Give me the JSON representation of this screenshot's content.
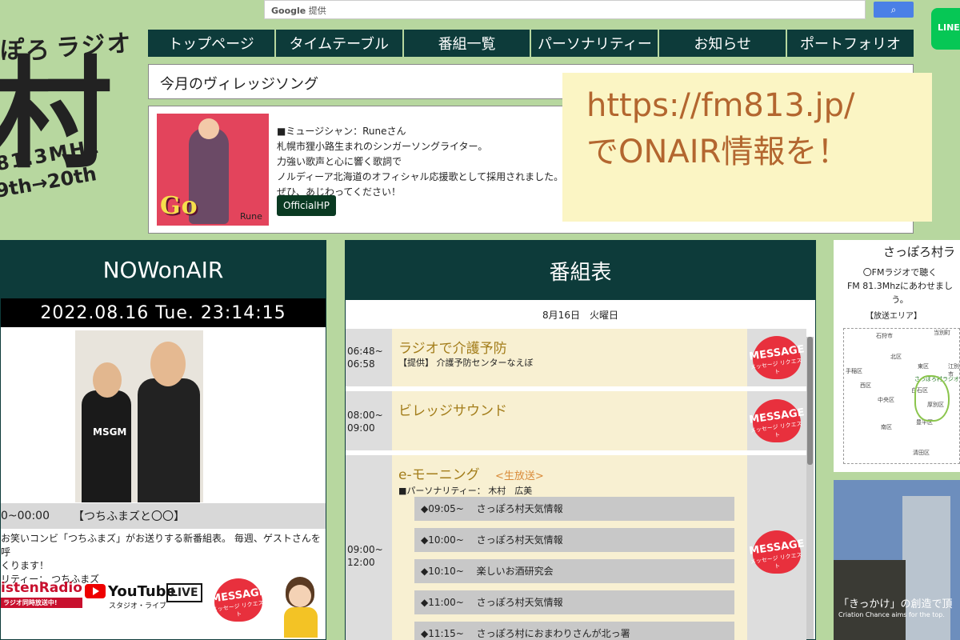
{
  "logo": {
    "line1": "ぽろ",
    "line2": "ラジオ",
    "big": "村",
    "freq": "81.3MHz",
    "sched": "9th→20th"
  },
  "search": {
    "label": "Google",
    "label_small": "提供",
    "button_icon": "search-icon"
  },
  "line_badge": "LINE",
  "nav": [
    "トップページ",
    "タイムテーブル",
    "番組一覧",
    "パーソナリティー",
    "お知らせ",
    "ポートフォリオ"
  ],
  "village_song": {
    "heading": "今月のヴィレッジソング"
  },
  "artist": {
    "lines": [
      "■ミュージシャン：Runeさん",
      "札幌市狸小路生まれのシンガーソングライター。",
      "力強い歌声と心に響く歌詞で",
      "ノルディーア北海道のオフィシャル応援歌として採用されました。",
      "ぜひ、あじわってください！"
    ],
    "button": "OfficialHP",
    "cover_title": "Go On！",
    "cover_name": "Rune"
  },
  "overlay": {
    "line1": "https://fm813.jp/",
    "line2": "でONAIR情報を！"
  },
  "now_on_air": {
    "heading": "NOWonAIR",
    "datetime": "2022.08.16 Tue. 23:14:15",
    "program_time": "0~00:00",
    "program_title": "【つちふまズと〇〇】",
    "desc1": "お笑いコンビ「つちふまズ」がお送りする新番組表。 毎週、ゲストさんを呼",
    "desc2": "くります！",
    "desc3": "リティー： つちふまズ",
    "photo_text": "MSGM",
    "listen_radio": "istenRadio",
    "listen_sub": "ラジオ同時放送中!",
    "youtube": "YouTube",
    "youtube_sub": "スタジオ・ライブ",
    "live": "LIVE"
  },
  "message_badge": {
    "main": "MESSAGE",
    "sub": "メッセージ リクエスト"
  },
  "program_table": {
    "heading": "番組表",
    "day": "8月16日　火曜日",
    "rows": [
      {
        "start": "06:48~",
        "end": "06:58",
        "title": "ラジオで介護予防",
        "sub": "【提供】 介護予防センターなえぼ"
      },
      {
        "start": "08:00~",
        "end": "09:00",
        "title": "ビレッジサウンド",
        "sub": ""
      },
      {
        "start": "09:00~",
        "end": "12:00",
        "title": "e-モーニング",
        "live": "<生放送>",
        "sub": "■パーソナリティー： 木村　広美"
      }
    ],
    "segments": [
      "◆09:05~　 さっぽろ村天気情報",
      "◆10:00~　 さっぽろ村天気情報",
      "◆10:10~　 楽しいお酒研究会",
      "◆11:00~　 さっぽろ村天気情報",
      "◆11:15~　 さっぽろ村におまわりさんが北っ署"
    ]
  },
  "map": {
    "title": "さっぽろ村ラ",
    "desc1": "〇FMラジオで聴く",
    "desc2": "FM 81.3Mhzにあわせまし",
    "desc3": "う。",
    "area_label": "【放送エリア】",
    "wards": [
      "石狩市",
      "当別町",
      "北区",
      "東区",
      "江別市",
      "手稲区",
      "西区",
      "中央区",
      "白石区",
      "厚別区",
      "南区",
      "豊平区",
      "清田区"
    ],
    "station": "さっぽろ村ラジオ"
  },
  "photo2": {
    "caption": "「きっかけ」の創造で頂",
    "caption_sub": "Criation Chance aims for the top."
  }
}
